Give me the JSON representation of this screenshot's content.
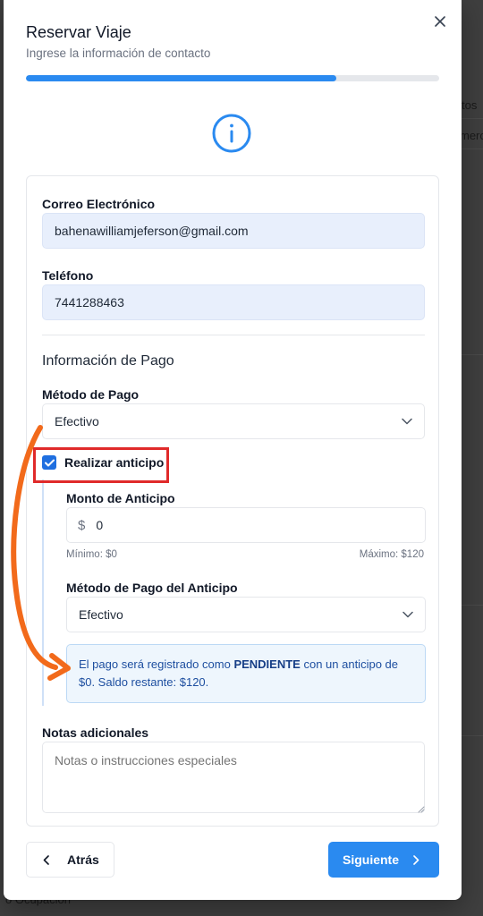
{
  "modal": {
    "title": "Reservar Viaje",
    "subtitle": "Ingrese la información de contacto",
    "progress_percent": 75
  },
  "contact": {
    "email_label": "Correo Electrónico",
    "email_value": "bahenawilliamjeferson@gmail.com",
    "phone_label": "Teléfono",
    "phone_value": "7441288463"
  },
  "payment": {
    "section_title": "Información de Pago",
    "method_label": "Método de Pago",
    "method_value": "Efectivo",
    "advance_checkbox_label": "Realizar anticipo",
    "advance_checked": true,
    "advance_amount_label": "Monto de Anticipo",
    "currency_symbol": "$",
    "advance_amount_value": "0",
    "min_hint": "Mínimo: $0",
    "max_hint": "Máximo: $120",
    "advance_method_label": "Método de Pago del Anticipo",
    "advance_method_value": "Efectivo",
    "notice_prefix": "El pago será registrado como",
    "notice_status": "PENDIENTE",
    "notice_suffix": "con un anticipo de $0. Saldo restante: $120."
  },
  "notes": {
    "label": "Notas adicionales",
    "placeholder": "Notas o instrucciones especiales"
  },
  "footer": {
    "back_label": "Atrás",
    "next_label": "Siguiente"
  },
  "background": {
    "fragment_top_right": "tos",
    "fragment_right": "mero",
    "fragment_bottom": "o Ocupación"
  },
  "colors": {
    "accent": "#2a8af0",
    "annotation_box": "#e02a2a",
    "annotation_arrow": "#f26a1b"
  },
  "icons": {
    "close": "close-icon",
    "info": "info-circle-icon",
    "chevron_down": "chevron-down-icon",
    "check": "check-icon",
    "chevron_left": "chevron-left-icon",
    "chevron_right": "chevron-right-icon"
  }
}
